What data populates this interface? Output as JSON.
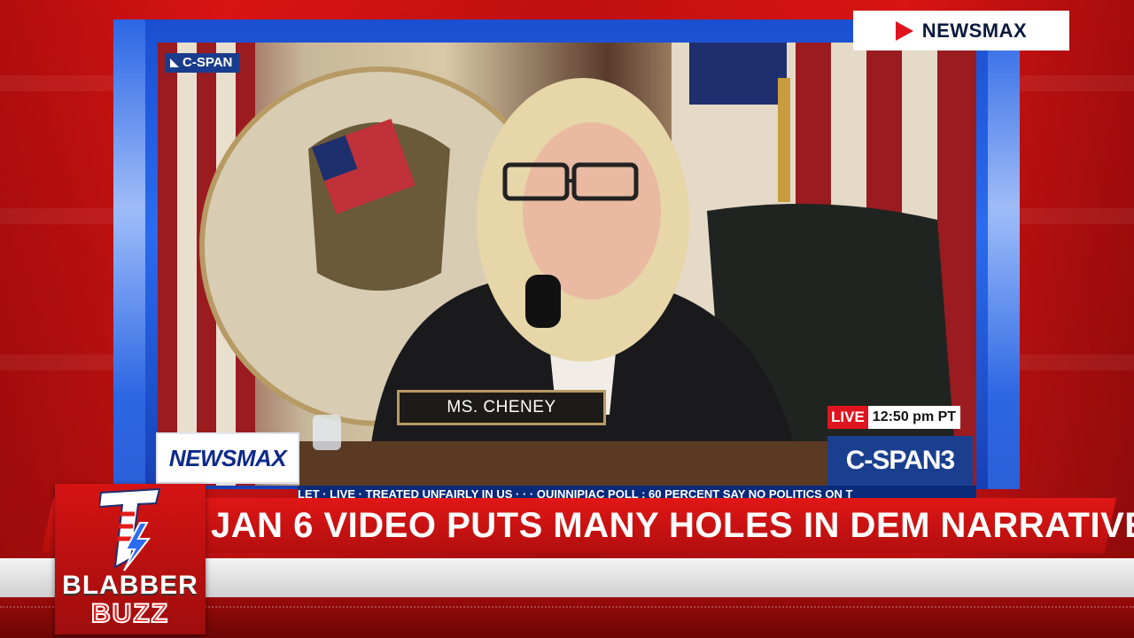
{
  "headline": "JAN 6 VIDEO PUTS MANY HOLES IN DEM NARRATIVE",
  "top_logo": {
    "label": "NEWSMAX",
    "icon": "play-icon",
    "accent": "#e0141e"
  },
  "video": {
    "corner_bug": "C-SPAN",
    "nameplate": "MS. CHENEY",
    "network_card": "NEWSMAX",
    "live_label": "LIVE",
    "time": "12:50 pm PT",
    "channel": "C-SPAN3",
    "ticker": "LET · LIVE · TREATED UNFAIRLY IN US · · · QUINNIPIAC POLL : 60 PERCENT SAY NO POLITICS ON T"
  },
  "brand": {
    "line1": "BLABBER",
    "line2": "BUZZ",
    "colors": {
      "primary": "#d51313",
      "dark": "#6d0606"
    }
  }
}
